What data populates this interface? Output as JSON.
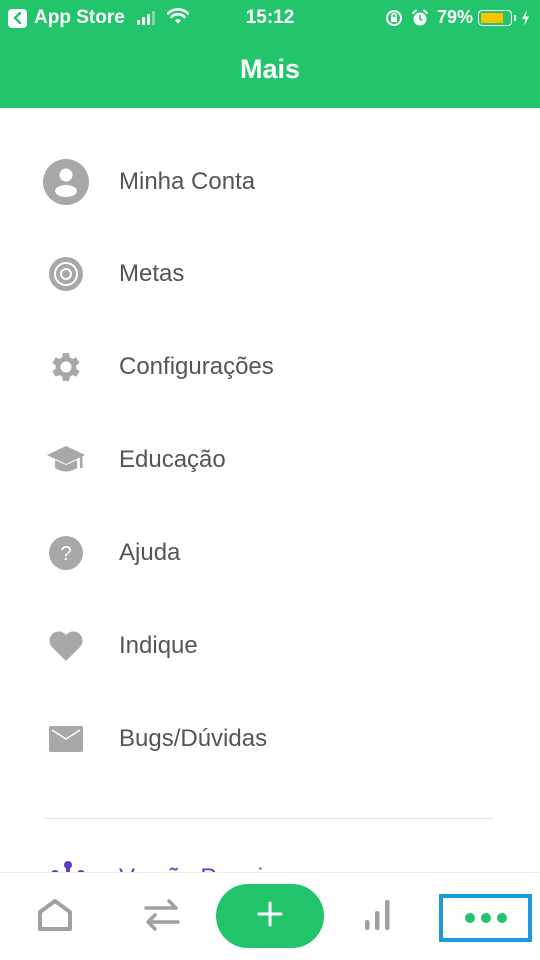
{
  "status_bar": {
    "back_app": "App Store",
    "time": "15:12",
    "battery_percent_text": "79%",
    "battery_level": 0.79,
    "signal_bars_active": 3,
    "signal_bars_total": 4,
    "icons": [
      "back-arrow-icon",
      "signal-icon",
      "wifi-icon",
      "rotation-lock-icon",
      "alarm-icon",
      "battery-icon",
      "charging-bolt-icon"
    ]
  },
  "header": {
    "title": "Mais",
    "background_color": "#22c56c"
  },
  "menu": {
    "items": [
      {
        "label": "Minha Conta",
        "icon": "account-icon"
      },
      {
        "label": "Metas",
        "icon": "target-icon"
      },
      {
        "label": "Configurações",
        "icon": "gear-icon"
      },
      {
        "label": "Educação",
        "icon": "graduation-cap-icon"
      },
      {
        "label": "Ajuda",
        "icon": "help-icon"
      },
      {
        "label": "Indique",
        "icon": "heart-icon"
      },
      {
        "label": "Bugs/Dúvidas",
        "icon": "mail-icon"
      }
    ],
    "premium": {
      "label": "Versão Premium",
      "icon": "premium-icon",
      "color": "#5f3dc4"
    }
  },
  "tabbar": {
    "tabs": [
      {
        "name": "home",
        "icon": "home-icon"
      },
      {
        "name": "transactions",
        "icon": "transfer-arrows-icon"
      },
      {
        "name": "add",
        "icon": "plus-icon"
      },
      {
        "name": "reports",
        "icon": "bar-chart-icon"
      },
      {
        "name": "more",
        "icon": "more-dots-icon",
        "selected": true
      }
    ],
    "accent_color": "#22c56c",
    "highlight_color": "#1a9be0"
  }
}
